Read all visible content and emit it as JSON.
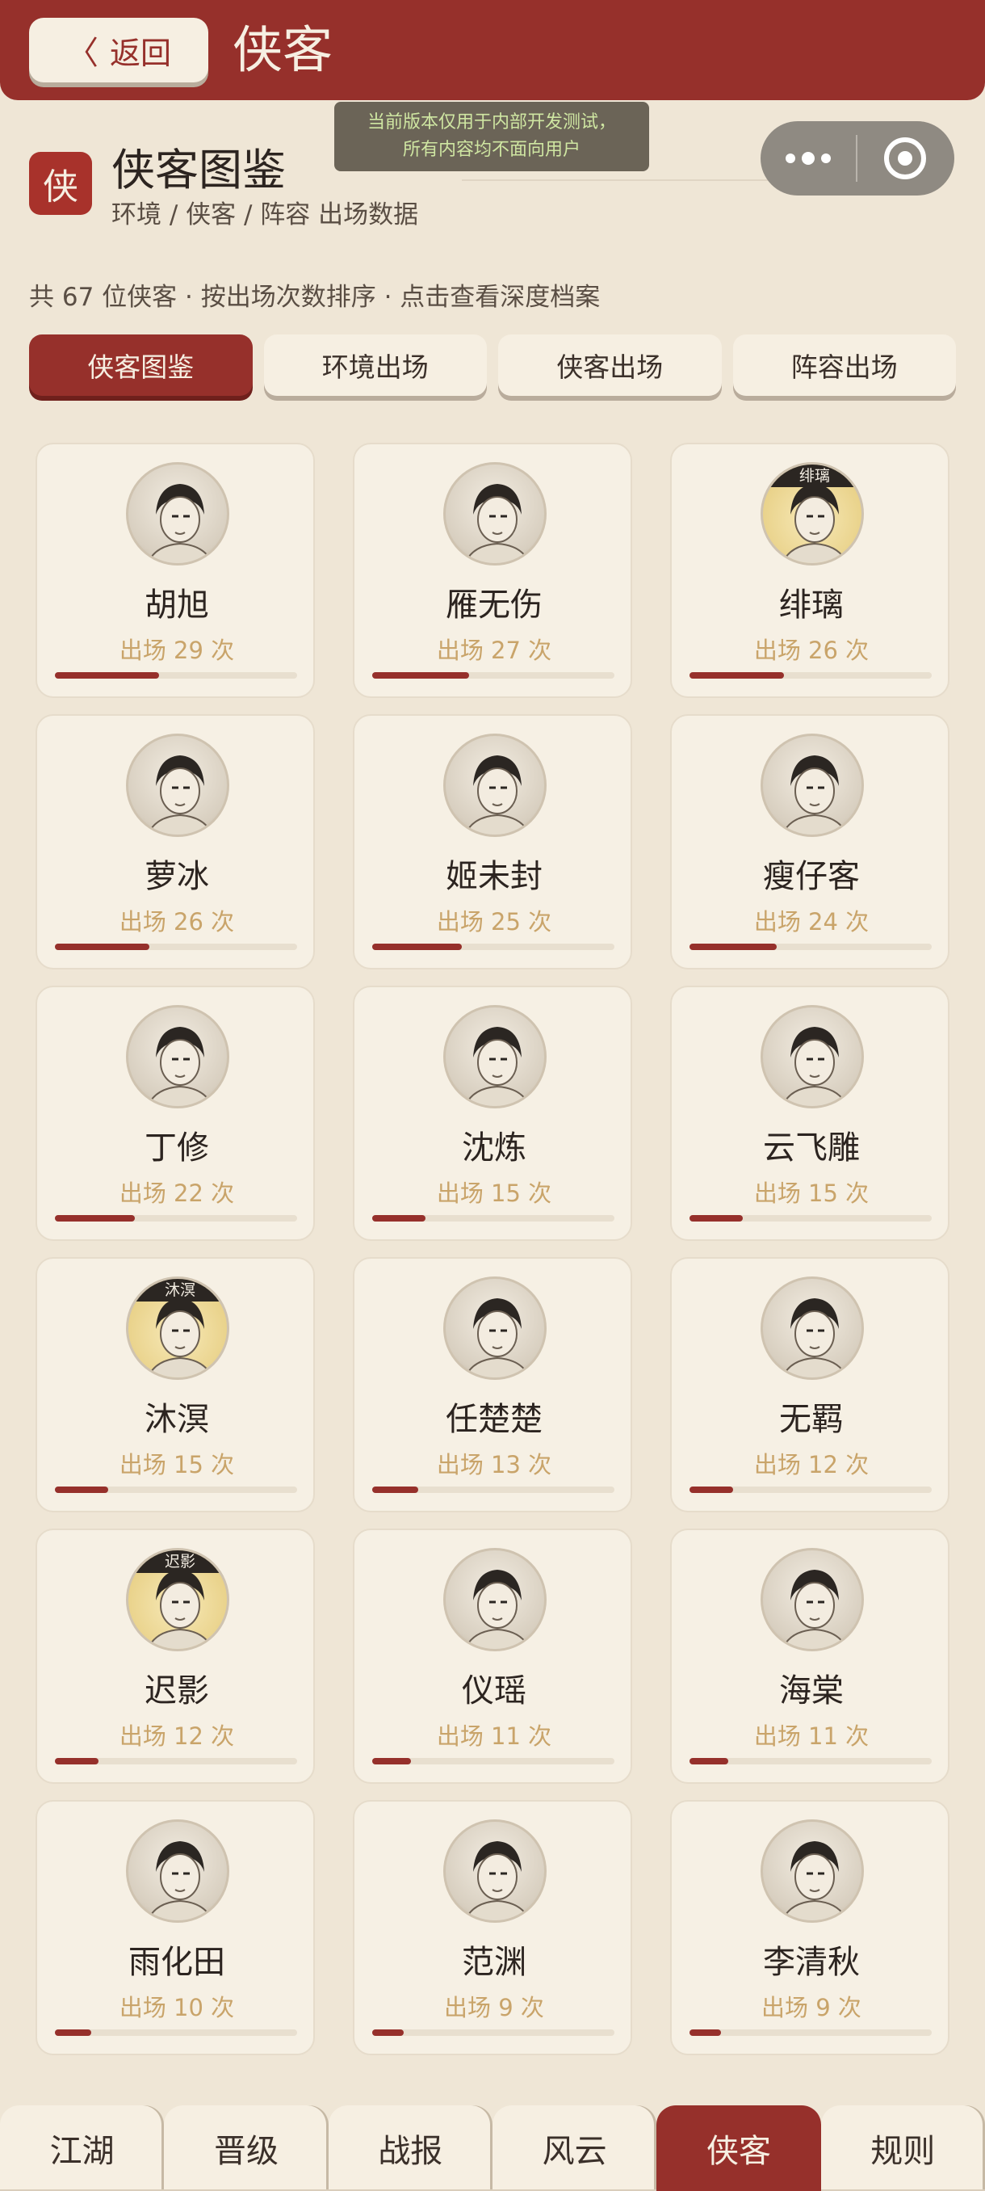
{
  "header": {
    "back_label": "返回",
    "back_icon": "chevron-left-icon",
    "title": "侠客"
  },
  "dev_notice": {
    "line1": "当前版本仅用于内部开发测试，",
    "line2": "所有内容均不面向用户"
  },
  "capsule": {
    "more_icon": "more-dots-icon",
    "close_icon": "target-ring-icon"
  },
  "section": {
    "seal": "侠",
    "title": "侠客图鉴",
    "breadcrumb": "环境 / 侠客 / 阵容 出场数据"
  },
  "summary": "共 67 位侠客 · 按出场次数排序 · 点击查看深度档案",
  "tabs": [
    {
      "label": "侠客图鉴",
      "active": true
    },
    {
      "label": "环境出场",
      "active": false
    },
    {
      "label": "侠客出场",
      "active": false
    },
    {
      "label": "阵容出场",
      "active": false
    }
  ],
  "max_appearances": 67,
  "heroes": [
    {
      "name": "胡旭",
      "count_text": "出场 29 次",
      "appearances": 29,
      "tag": ""
    },
    {
      "name": "雁无伤",
      "count_text": "出场 27 次",
      "appearances": 27,
      "tag": ""
    },
    {
      "name": "绯璃",
      "count_text": "出场 26 次",
      "appearances": 26,
      "tag": "绯璃"
    },
    {
      "name": "萝冰",
      "count_text": "出场 26 次",
      "appearances": 26,
      "tag": ""
    },
    {
      "name": "姬未封",
      "count_text": "出场 25 次",
      "appearances": 25,
      "tag": ""
    },
    {
      "name": "瘦仔客",
      "count_text": "出场 24 次",
      "appearances": 24,
      "tag": ""
    },
    {
      "name": "丁修",
      "count_text": "出场 22 次",
      "appearances": 22,
      "tag": ""
    },
    {
      "name": "沈炼",
      "count_text": "出场 15 次",
      "appearances": 15,
      "tag": ""
    },
    {
      "name": "云飞雕",
      "count_text": "出场 15 次",
      "appearances": 15,
      "tag": ""
    },
    {
      "name": "沐溟",
      "count_text": "出场 15 次",
      "appearances": 15,
      "tag": "沐溟"
    },
    {
      "name": "任楚楚",
      "count_text": "出场 13 次",
      "appearances": 13,
      "tag": ""
    },
    {
      "name": "无羁",
      "count_text": "出场 12 次",
      "appearances": 12,
      "tag": ""
    },
    {
      "name": "迟影",
      "count_text": "出场 12 次",
      "appearances": 12,
      "tag": "迟影"
    },
    {
      "name": "仪瑶",
      "count_text": "出场 11 次",
      "appearances": 11,
      "tag": ""
    },
    {
      "name": "海棠",
      "count_text": "出场 11 次",
      "appearances": 11,
      "tag": ""
    },
    {
      "name": "雨化田",
      "count_text": "出场 10 次",
      "appearances": 10,
      "tag": ""
    },
    {
      "name": "范渊",
      "count_text": "出场 9 次",
      "appearances": 9,
      "tag": ""
    },
    {
      "name": "李清秋",
      "count_text": "出场 9 次",
      "appearances": 9,
      "tag": ""
    }
  ],
  "bottom_nav": [
    {
      "label": "江湖",
      "active": false
    },
    {
      "label": "晋级",
      "active": false
    },
    {
      "label": "战报",
      "active": false
    },
    {
      "label": "风云",
      "active": false
    },
    {
      "label": "侠客",
      "active": true
    },
    {
      "label": "规则",
      "active": false
    }
  ],
  "colors": {
    "accent": "#96302b",
    "background": "#efe6d6",
    "card": "#f6f0e4",
    "count_text": "#c9a46a"
  }
}
